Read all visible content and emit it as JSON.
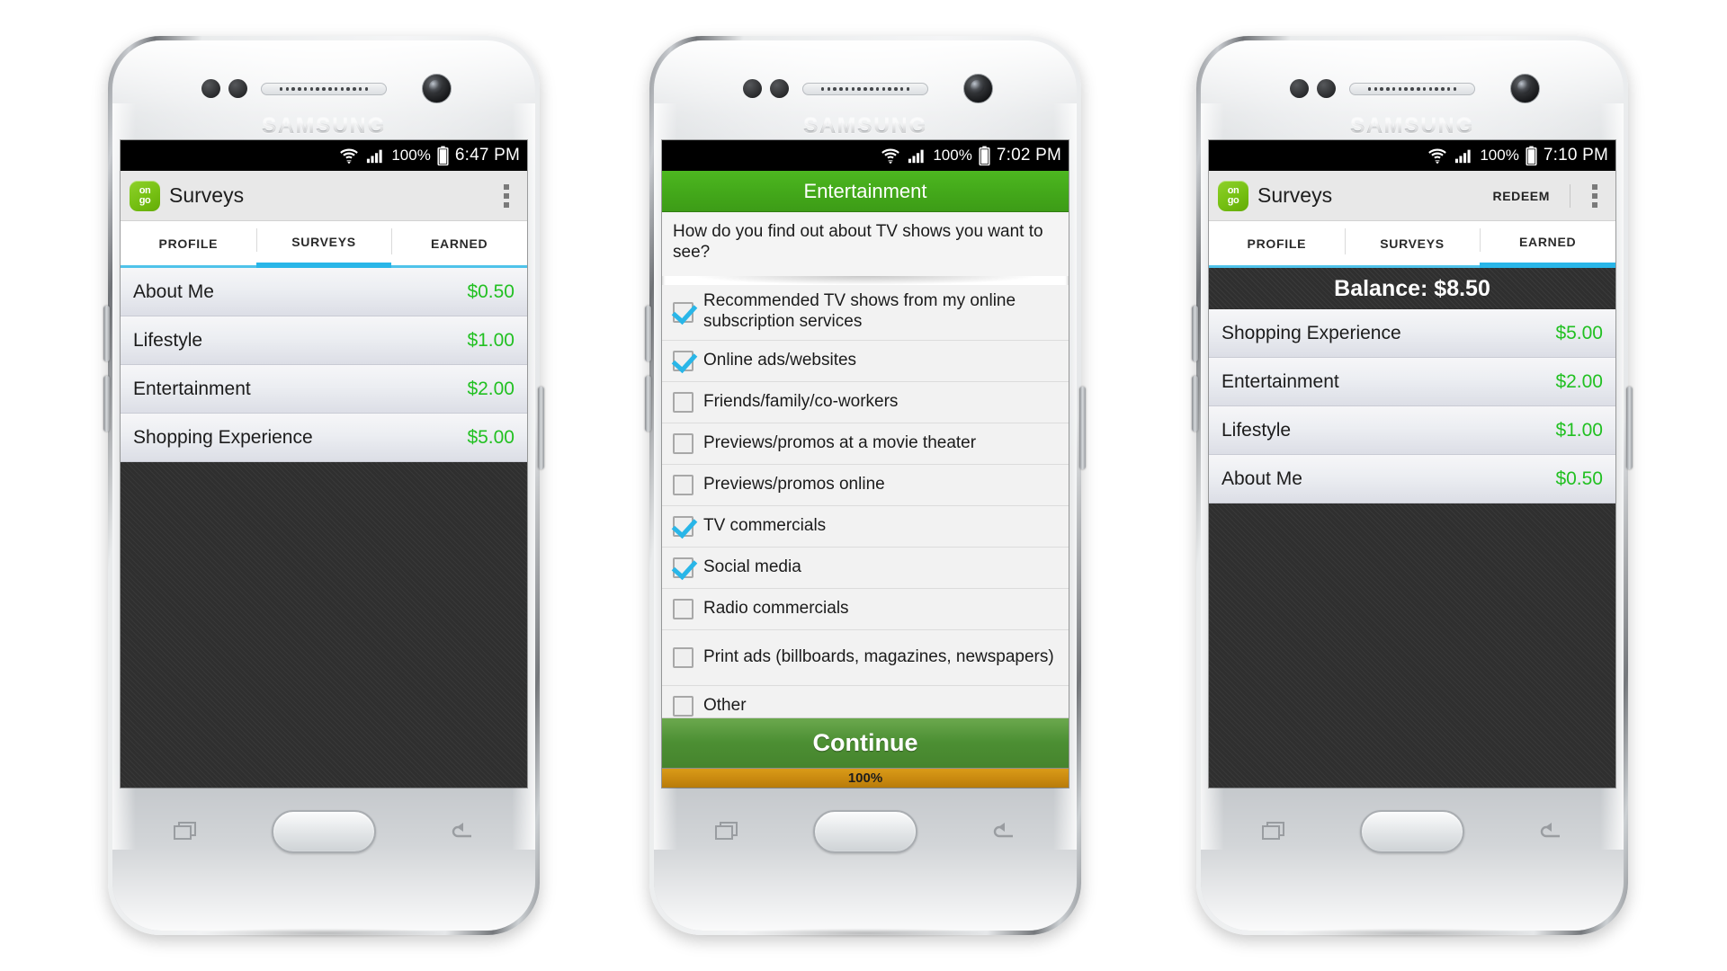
{
  "meta": {
    "device_brand": "SAMSUNG",
    "app_name": "Surveys"
  },
  "phone1": {
    "statusbar": {
      "battery_pct": "100%",
      "time": "6:47 PM"
    },
    "appbar": {
      "title": "Surveys"
    },
    "tabs": [
      {
        "label": "PROFILE",
        "active": false
      },
      {
        "label": "SURVEYS",
        "active": true
      },
      {
        "label": "EARNED",
        "active": false
      }
    ],
    "rows": [
      {
        "label": "About Me",
        "price": "$0.50"
      },
      {
        "label": "Lifestyle",
        "price": "$1.00"
      },
      {
        "label": "Entertainment",
        "price": "$2.00"
      },
      {
        "label": "Shopping Experience",
        "price": "$5.00"
      }
    ]
  },
  "phone2": {
    "statusbar": {
      "battery_pct": "100%",
      "time": "7:02 PM"
    },
    "header": {
      "title": "Entertainment"
    },
    "question": "How do you find out about TV shows you want to see?",
    "options": [
      {
        "label": "Recommended TV shows from my online subscription services",
        "checked": true
      },
      {
        "label": "Online ads/websites",
        "checked": true
      },
      {
        "label": "Friends/family/co-workers",
        "checked": false
      },
      {
        "label": "Previews/promos at a movie theater",
        "checked": false
      },
      {
        "label": "Previews/promos online",
        "checked": false
      },
      {
        "label": "TV commercials",
        "checked": true
      },
      {
        "label": "Social media",
        "checked": true
      },
      {
        "label": "Radio commercials",
        "checked": false
      },
      {
        "label": "Print ads (billboards, magazines, newspapers)",
        "checked": false
      },
      {
        "label": "Other",
        "checked": false
      }
    ],
    "continue_label": "Continue",
    "progress_label": "100%"
  },
  "phone3": {
    "statusbar": {
      "battery_pct": "100%",
      "time": "7:10 PM"
    },
    "appbar": {
      "title": "Surveys",
      "redeem_label": "REDEEM"
    },
    "tabs": [
      {
        "label": "PROFILE",
        "active": false
      },
      {
        "label": "SURVEYS",
        "active": false
      },
      {
        "label": "EARNED",
        "active": true
      }
    ],
    "balance_label": "Balance: $8.50",
    "rows": [
      {
        "label": "Shopping Experience",
        "price": "$5.00"
      },
      {
        "label": "Entertainment",
        "price": "$2.00"
      },
      {
        "label": "Lifestyle",
        "price": "$1.00"
      },
      {
        "label": "About Me",
        "price": "$0.50"
      }
    ]
  },
  "colors": {
    "tab_accent": "#29b6e8",
    "price_green": "#22c022",
    "header_green": "#43a81a",
    "continue_green": "#4c8f33",
    "progress_orange": "#c98910",
    "dark_fill": "#2f2f2f"
  }
}
